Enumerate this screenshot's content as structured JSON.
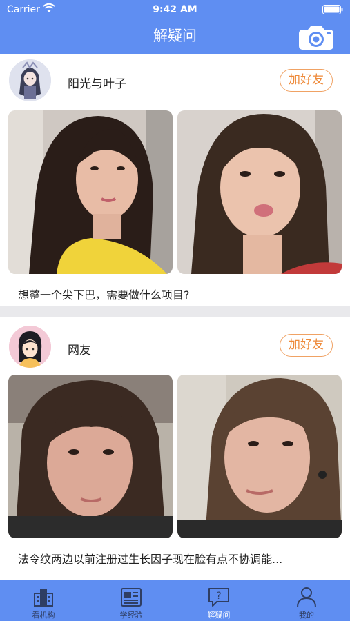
{
  "status_bar": {
    "carrier": "Carrier",
    "time": "9:42 AM"
  },
  "nav": {
    "title": "解疑问",
    "camera_icon": "camera-icon"
  },
  "posts": [
    {
      "username": "阳光与叶子",
      "add_friend_label": "加好友",
      "caption": "想整一个尖下巴，需要做什么项目?"
    },
    {
      "username": "网友",
      "add_friend_label": "加好友",
      "caption": "法令纹两边以前注册过生长因子现在脸有点不协调能..."
    }
  ],
  "tabs": [
    {
      "label": "看机构",
      "icon": "building-icon"
    },
    {
      "label": "学经验",
      "icon": "newspaper-icon"
    },
    {
      "label": "解疑问",
      "icon": "question-bubble-icon",
      "active": true
    },
    {
      "label": "我的",
      "icon": "person-icon"
    }
  ],
  "colors": {
    "brand_blue": "#5f8ef2",
    "accent_orange": "#ee8a3a",
    "background": "#e9e9ec"
  }
}
